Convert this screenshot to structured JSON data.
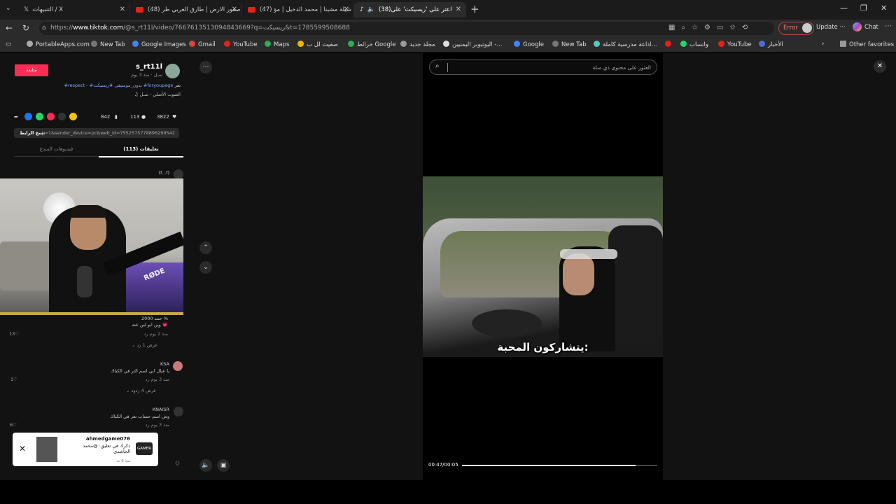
{
  "tabs": [
    {
      "label": "التنبيهات / X",
      "icon": "x-logo-icon"
    },
    {
      "label": "(48) صقور الارض | طارق العربي طر",
      "icon": "youtube-icon"
    },
    {
      "label": "(47) شيلة مشينا | محمد الدخيل | مؤ",
      "icon": "youtube-icon"
    },
    {
      "label": "(38)اعثر على 'ريسيكت' على",
      "icon": "tiktok-icon"
    }
  ],
  "address": {
    "url_prefix": "https://",
    "url_host": "www.tiktok.com",
    "url_rest": "/@s_rt11l/video/7667613513094843669?q=ريسيكت&t=1785599508688",
    "error_label": "Error",
    "update_label": "Update",
    "chat_label": "Chat"
  },
  "bookmarks": [
    "PortableApps.com",
    "New Tab",
    "Google Images",
    "Gmail",
    "YouTube",
    "Maps",
    "صفيت لل ب",
    "خرائط Google",
    "مجلد جديد",
    "اليوتيوبر اليمنيين -...",
    "Google",
    "New Tab",
    "اذاعة مدرسية كاملة...",
    "واتساب",
    "YouTube",
    "الأخبار",
    "Other favorites"
  ],
  "post": {
    "follow_label": "متابعة",
    "username": "s_rt11l",
    "subtitle": "سـل · منذ 3 يوم",
    "desc_prefix": "تعر",
    "desc_tags": "#respect - #بدون_موسيقى #ريسيكت #foryoupage",
    "sound": "الصوت الأصلي - سـل",
    "likes": "3822",
    "comments": "113",
    "saves": "842",
    "copy_link_label": "نسخ الرابط",
    "link_text": "...p=1&sender_device=pc&web_id=7552575778896299542",
    "tab_comments": "(113) تعليقات",
    "tab_videos": "فيديوهات المبدع"
  },
  "comments": [
    {
      "author": "(f...f)",
      "text": "",
      "meta": "",
      "likes": ""
    },
    {
      "author": "حمد 2000 %",
      "text": "وين ابو لين عنه 💗",
      "meta": "منذ 2 يوم   رد",
      "likes": "13",
      "replies": "عرض 1 رد"
    },
    {
      "author": "KSA",
      "text": "يا عيال ابي اسم الثر في الكباك",
      "meta": "منذ 3 يوم   رد",
      "likes": "1",
      "replies": "عرض 4 ردود"
    },
    {
      "author": "KNAISR",
      "text": "وش اسم حساب تعر في الكباك",
      "meta": "منذ 3 يوم   رد",
      "likes": "6",
      "replies": ""
    }
  ],
  "notification": {
    "name": "ahmedgame076",
    "text": "ذكرك في تعليق: @محمد الحاشدي",
    "time": "منذ 6 ث",
    "logo": "GAMER"
  },
  "video": {
    "search_placeholder": "العثور على محتوى ذي صلة",
    "subtitle": "يتشاركون المحبة:",
    "timecode": "00:47/00:05",
    "progress": 0.89
  },
  "icons": {
    "close": "close-icon",
    "search": "search-icon",
    "chevron_up": "chevron-up-icon",
    "chevron_down": "chevron-down-icon",
    "more": "more-icon",
    "volume": "volume-icon"
  },
  "colors": {
    "accent": "#fe2c55",
    "tag": "#7ea6ff"
  }
}
